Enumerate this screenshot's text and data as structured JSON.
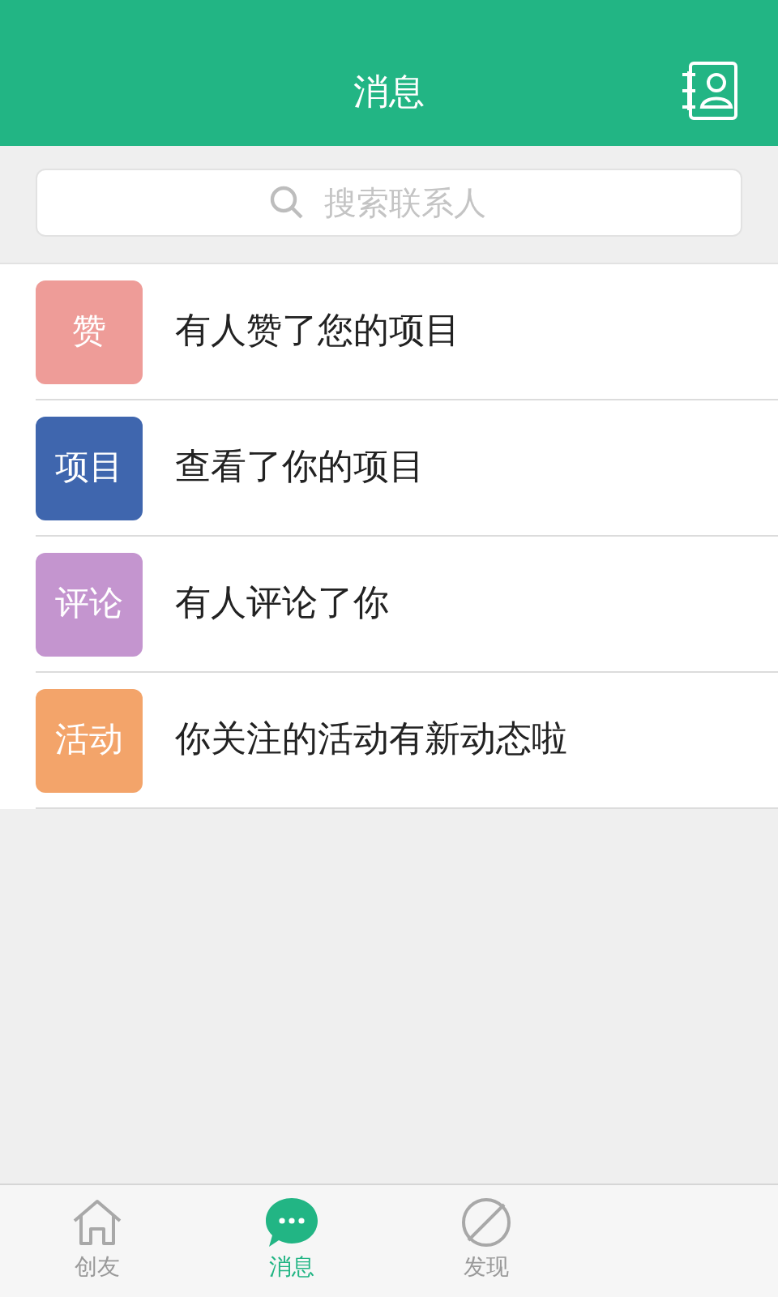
{
  "header": {
    "title": "消息"
  },
  "search": {
    "placeholder": "搜索联系人"
  },
  "messages": [
    {
      "badge": "赞",
      "color": "#ee9c98",
      "text": "有人赞了您的项目"
    },
    {
      "badge": "项目",
      "color": "#3f66ae",
      "text": "查看了你的项目"
    },
    {
      "badge": "评论",
      "color": "#c495cf",
      "text": "有人评论了你"
    },
    {
      "badge": "活动",
      "color": "#f3a46a",
      "text": "你关注的活动有新动态啦"
    }
  ],
  "tabs": [
    {
      "kind": "home",
      "label": "创友",
      "selected": false
    },
    {
      "kind": "chat",
      "label": "消息",
      "selected": true
    },
    {
      "kind": "discover",
      "label": "发现",
      "selected": false
    }
  ]
}
